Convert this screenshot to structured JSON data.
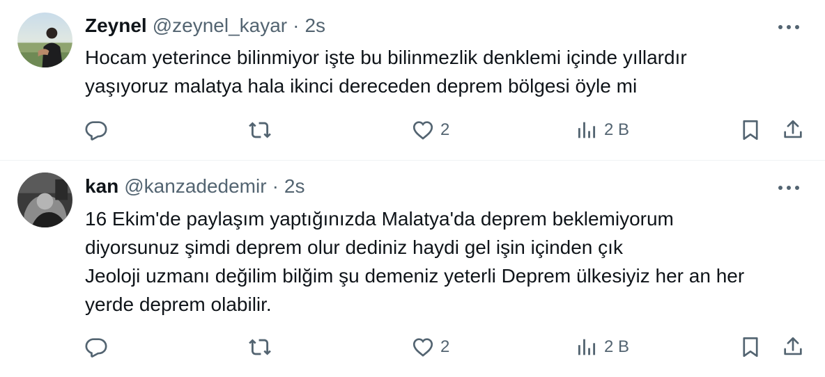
{
  "tweets": [
    {
      "display_name": "Zeynel",
      "handle": "@zeynel_kayar",
      "separator": "·",
      "time": "2s",
      "text": "Hocam yeterince bilinmiyor işte bu bilinmezlik denklemi içinde yıllardır\nyaşıyoruz malatya hala ikinci dereceden deprem bölgesi öyle mi",
      "likes": "2",
      "views": "2 B"
    },
    {
      "display_name": "kan",
      "handle": "@kanzadedemir",
      "separator": "·",
      "time": "2s",
      "text": "16 Ekim'de paylaşım yaptığınızda Malatya'da deprem beklemiyorum\ndiyorsunuz şimdi deprem olur dediniz haydi gel işin içinden çık\nJeoloji uzmanı değilim bilğim şu demeniz yeterli Deprem ülkesiyiz her an her\nyerde deprem olabilir.",
      "likes": "2",
      "views": "2 B"
    }
  ],
  "icons": {
    "reply": "reply-icon",
    "retweet": "retweet-icon",
    "like": "heart-icon",
    "views": "views-icon",
    "bookmark": "bookmark-icon",
    "share": "share-icon",
    "more": "more-icon"
  },
  "colors": {
    "text": "#0f1419",
    "secondary": "#536471",
    "divider": "#eff3f4"
  }
}
